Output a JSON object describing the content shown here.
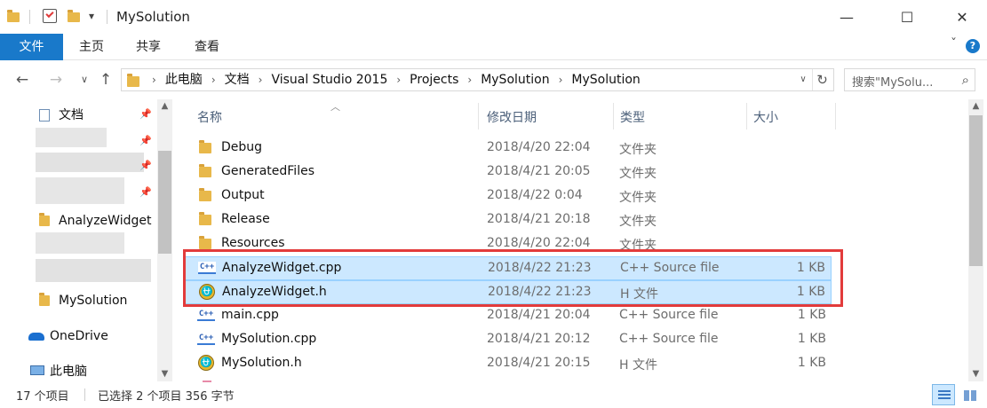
{
  "window": {
    "title": "MySolution",
    "minimize": "—",
    "maximize": "☐",
    "close": "✕"
  },
  "quick_access": {
    "qa_dropdown": "▾"
  },
  "ribbon": {
    "tabs": [
      "文件",
      "主页",
      "共享",
      "查看"
    ],
    "expand": "ˇ",
    "help": "?"
  },
  "nav": {
    "back": "←",
    "forward": "→",
    "recent": "∨",
    "up": "↑",
    "breadcrumb": [
      "此电脑",
      "文档",
      "Visual Studio 2015",
      "Projects",
      "MySolution",
      "MySolution"
    ],
    "crumb_sep": "›",
    "address_dropdown": "∨",
    "refresh": "↻",
    "search_placeholder": "搜索\"MySolu...",
    "search_icon": "⌕"
  },
  "left_pane": {
    "items": [
      {
        "label": "文档",
        "icon": "docs-icon",
        "pinned": true
      },
      {
        "label": "AnalyzeWidget",
        "icon": "folder-icon"
      },
      {
        "label": "MySolution",
        "icon": "folder-icon"
      },
      {
        "label": "OneDrive",
        "icon": "onedrive-icon"
      },
      {
        "label": "此电脑",
        "icon": "computer-icon"
      }
    ],
    "pin_glyph": "📌"
  },
  "columns": {
    "name": "名称",
    "date": "修改日期",
    "type": "类型",
    "size": "大小",
    "sort_glyph": "︿"
  },
  "files": [
    {
      "name": "Debug",
      "date": "2018/4/20 22:04",
      "type": "文件夹",
      "size": "",
      "icon": "folder-icon",
      "selected": false
    },
    {
      "name": "GeneratedFiles",
      "date": "2018/4/21 20:05",
      "type": "文件夹",
      "size": "",
      "icon": "folder-icon",
      "selected": false
    },
    {
      "name": "Output",
      "date": "2018/4/22 0:04",
      "type": "文件夹",
      "size": "",
      "icon": "folder-icon",
      "selected": false
    },
    {
      "name": "Release",
      "date": "2018/4/21 20:18",
      "type": "文件夹",
      "size": "",
      "icon": "folder-icon",
      "selected": false
    },
    {
      "name": "Resources",
      "date": "2018/4/20 22:04",
      "type": "文件夹",
      "size": "",
      "icon": "folder-icon",
      "selected": false
    },
    {
      "name": "AnalyzeWidget.cpp",
      "date": "2018/4/22 21:23",
      "type": "C++ Source file",
      "size": "1 KB",
      "icon": "cpp-file-icon",
      "selected": true
    },
    {
      "name": "AnalyzeWidget.h",
      "date": "2018/4/22 21:23",
      "type": "H 文件",
      "size": "1 KB",
      "icon": "header-file-icon",
      "selected": true
    },
    {
      "name": "main.cpp",
      "date": "2018/4/21 20:04",
      "type": "C++ Source file",
      "size": "1 KB",
      "icon": "cpp-file-icon",
      "selected": false
    },
    {
      "name": "MySolution.cpp",
      "date": "2018/4/21 20:12",
      "type": "C++ Source file",
      "size": "1 KB",
      "icon": "cpp-file-icon",
      "selected": false
    },
    {
      "name": "MySolution.h",
      "date": "2018/4/21 20:15",
      "type": "H 文件",
      "size": "1 KB",
      "icon": "header-file-icon",
      "selected": false
    }
  ],
  "icons": {
    "cpp_label": "C++",
    "h_label": "⛎"
  },
  "status": {
    "item_count": "17 个项目",
    "selection": "已选择 2 个项目  356 字节"
  },
  "colors": {
    "accent": "#1979ca",
    "selection_bg": "#cce8ff",
    "highlight_border": "#e23b3b",
    "folder": "#e8b84a"
  }
}
